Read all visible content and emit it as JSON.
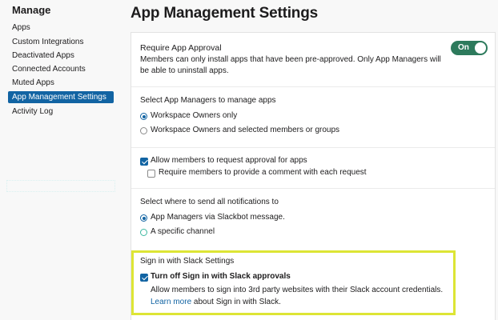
{
  "sidebar": {
    "title": "Manage",
    "items": [
      {
        "label": "Apps"
      },
      {
        "label": "Custom Integrations"
      },
      {
        "label": "Deactivated Apps"
      },
      {
        "label": "Connected Accounts"
      },
      {
        "label": "Muted Apps"
      },
      {
        "label": "App Management Settings"
      },
      {
        "label": "Activity Log"
      }
    ]
  },
  "page": {
    "title": "App Management Settings"
  },
  "approval": {
    "title": "Require App Approval",
    "description": "Members can only install apps that have been pre-approved. Only App Managers will be able to uninstall apps.",
    "toggle_label": "On"
  },
  "managers": {
    "title": "Select App Managers to manage apps",
    "options": [
      {
        "label": "Workspace Owners only",
        "checked": true
      },
      {
        "label": "Workspace Owners and selected members or groups",
        "checked": false
      }
    ]
  },
  "requests": {
    "allow_label": "Allow members to request approval for apps",
    "comment_label": "Require members to provide a comment with each request"
  },
  "notifications": {
    "title": "Select where to send all notifications to",
    "options": [
      {
        "label": "App Managers via Slackbot message.",
        "checked": true
      },
      {
        "label": "A specific channel",
        "checked": false
      }
    ]
  },
  "signin": {
    "title": "Sign in with Slack Settings",
    "option_label": "Turn off Sign in with Slack approvals",
    "description": "Allow members to sign into 3rd party websites with their Slack account credentials.",
    "learn_more": "Learn more",
    "learn_more_suffix": " about Sign in with Slack."
  },
  "colors": {
    "accent": "#1264a3",
    "toggle_on": "#2d7a5c",
    "highlight": "#dde535"
  }
}
